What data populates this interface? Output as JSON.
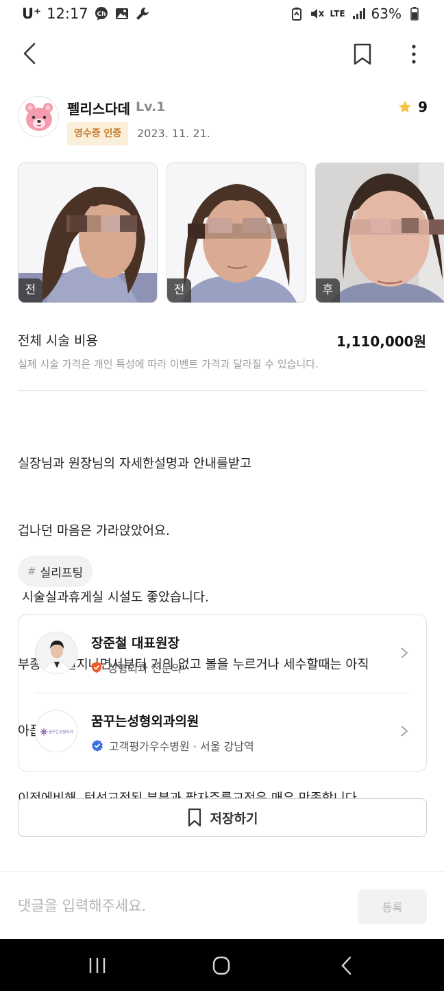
{
  "status_bar": {
    "carrier": "U⁺",
    "time": "12:17",
    "battery": "63%",
    "network": "LTE"
  },
  "author": {
    "name": "펠리스다데",
    "level": "Lv.1",
    "badge": "영수증 인증",
    "date": "2023. 11. 21.",
    "rating": "9"
  },
  "photos": [
    {
      "label": "전"
    },
    {
      "label": "전"
    },
    {
      "label": "후"
    }
  ],
  "cost": {
    "title": "전체 시술 비용",
    "value": "1,110,000원",
    "note": "실제 시술 가격은 개인 특성에 따라 이벤트 가격과 달라질 수 있습니다."
  },
  "review": {
    "lines": [
      "실장님과 원장님의 자세한설명과 안내를받고",
      "겁나던 마음은 가라앉았어요.",
      " 시술실과휴게실 시설도 좋았습니다.",
      "부종은 4일지나면서부터 거의 없고 볼을 누르거나 세수할때는 아직",
      "아픕니다.",
      "이전에비해  턱선교정된 부분과 팔자주름교정은 매우 만족합니다"
    ]
  },
  "tag": {
    "hash": "#",
    "label": "실리프팅"
  },
  "doctor": {
    "name": "장준철 대표원장",
    "specialty": "성형외과 전문의"
  },
  "hospital": {
    "name": "꿈꾸는성형외과의원",
    "info": "고객평가우수병원 · 서울 강남역",
    "logo_text": "꿈꾸는성형외과"
  },
  "save_button": {
    "label": "저장하기"
  },
  "comment": {
    "placeholder": "댓글을 입력해주세요.",
    "value": "",
    "submit_label": "등록"
  },
  "colors": {
    "badge_bg": "#fcefd9",
    "badge_text": "#c27a2c",
    "star": "#f5c242",
    "verified_orange": "#f05a28",
    "verified_blue": "#3b6fe0"
  }
}
